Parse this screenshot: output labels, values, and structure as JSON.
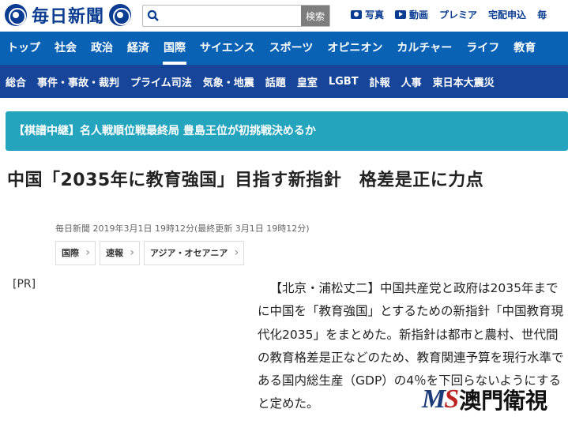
{
  "header": {
    "logo_text": "毎日新聞",
    "search_placeholder": "",
    "search_button": "検索",
    "links": [
      {
        "label": "写真",
        "icon": "camera-icon"
      },
      {
        "label": "動画",
        "icon": "play-icon"
      },
      {
        "label": "プレミア"
      },
      {
        "label": "宅配申込"
      },
      {
        "label": "毎"
      }
    ]
  },
  "nav_primary": [
    "トップ",
    "社会",
    "政治",
    "経済",
    "国際",
    "サイエンス",
    "スポーツ",
    "オピニオン",
    "カルチャー",
    "ライフ",
    "教育"
  ],
  "nav_primary_active": "国際",
  "nav_secondary": [
    "総合",
    "事件・事故・裁判",
    "プライム司法",
    "気象・地震",
    "話題",
    "皇室",
    "LGBT",
    "訃報",
    "人事",
    "東日本大震災"
  ],
  "banner": {
    "text": "【棋譜中継】名人戦順位戦最終局 豊島王位が初挑戦決めるか"
  },
  "article": {
    "headline": "中国「2035年に教育強国」目指す新指針　格差是正に力点",
    "meta": "毎日新聞 2019年3月1日 19時12分(最終更新 3月1日 19時12分)",
    "tags": [
      "国際",
      "速報",
      "アジア・オセアニア"
    ],
    "pr_label": "[PR]",
    "body": "【北京・浦松丈二】中国共産党と政府は2035年までに中国を「教育強国」とするための新指針「中国教育現代化2035」をまとめた。新指針は都市と農村、世代間の教育格差是正などのため、教育関連予算を現行水準である国内総生産（GDP）の4％を下回らないようにすると定めた。"
  },
  "watermark": {
    "ms": "MS",
    "text": "澳門衛視"
  },
  "colors": {
    "nav_primary": "#0a62b5",
    "nav_secondary": "#16459a",
    "banner": "#24a5bd",
    "brand": "#0a3d91"
  }
}
